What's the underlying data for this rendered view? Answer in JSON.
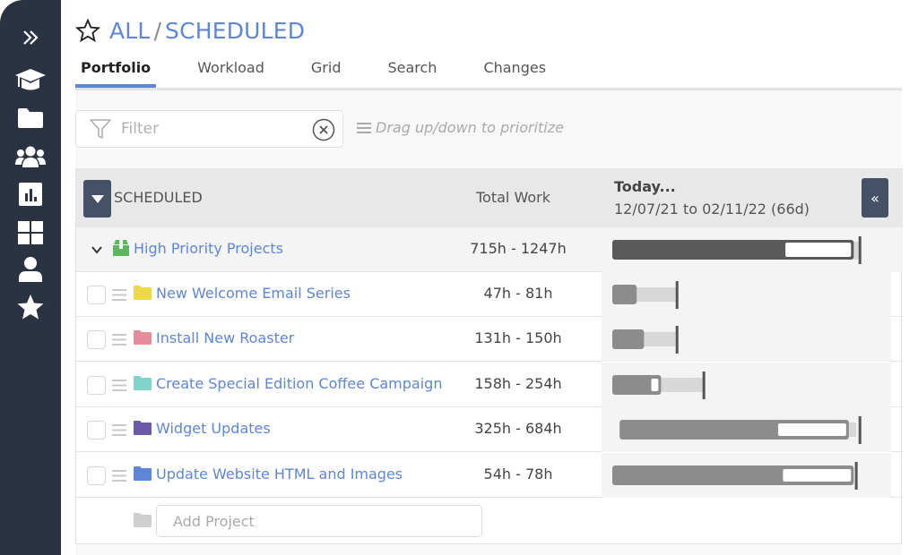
{
  "sidebar": {
    "items": [
      {
        "id": "expand",
        "icon": "double-chevron-right-icon"
      },
      {
        "id": "learn",
        "icon": "graduation-cap-icon"
      },
      {
        "id": "projects",
        "icon": "folder-icon"
      },
      {
        "id": "team",
        "icon": "users-icon"
      },
      {
        "id": "reports",
        "icon": "bar-chart-icon"
      },
      {
        "id": "dashboard",
        "icon": "grid-icon"
      },
      {
        "id": "profile",
        "icon": "user-icon"
      },
      {
        "id": "favorites",
        "icon": "star-icon"
      }
    ]
  },
  "header": {
    "breadcrumb": {
      "root": "ALL",
      "separator": "/",
      "current": "SCHEDULED"
    },
    "tabs": [
      {
        "label": "Portfolio",
        "active": true
      },
      {
        "label": "Workload",
        "active": false
      },
      {
        "label": "Grid",
        "active": false
      },
      {
        "label": "Search",
        "active": false
      },
      {
        "label": "Changes",
        "active": false
      }
    ]
  },
  "toolbar": {
    "filter_placeholder": "Filter",
    "filter_value": "",
    "drag_hint": "Drag up/down to prioritize"
  },
  "table": {
    "header": {
      "section": "SCHEDULED",
      "total_work": "Total Work",
      "today": "Today...",
      "range": "12/07/21 to 02/11/22 (66d)",
      "expand_glyph": "«"
    },
    "group": {
      "name": "High Priority Projects",
      "work": "715h - 1247h",
      "icon_color": "#5cb85c",
      "gantt": {
        "start": 0.0,
        "end": 0.99,
        "done_fraction": 0.71,
        "deadline": 1.01,
        "color": "#595959"
      }
    },
    "rows": [
      {
        "name": "New Welcome Email Series",
        "work": "47h - 81h",
        "folder_color": "#ecd94a",
        "gantt": {
          "start": 0.0,
          "done": 0.1,
          "end": 0.26,
          "deadline": 0.26,
          "inner_white": false
        }
      },
      {
        "name": "Install New Roaster",
        "work": "131h - 150h",
        "folder_color": "#e68d9b",
        "gantt": {
          "start": 0.0,
          "done": 0.13,
          "end": 0.26,
          "deadline": 0.26,
          "inner_white": false
        }
      },
      {
        "name": "Create Special Edition Coffee Campaign",
        "work": "158h - 254h",
        "folder_color": "#7fd3c8",
        "gantt": {
          "start": 0.0,
          "done": 0.2,
          "end": 0.37,
          "deadline": 0.37,
          "inner_white": true,
          "white_start": 0.16
        }
      },
      {
        "name": "Widget Updates",
        "work": "325h - 684h",
        "folder_color": "#6a5aa8",
        "gantt": {
          "start": 0.03,
          "done": 0.97,
          "end": 1.0,
          "deadline": 1.01,
          "inner_white": true,
          "white_start": 0.68
        }
      },
      {
        "name": "Update Website HTML and Images",
        "work": "54h - 78h",
        "folder_color": "#5e86d6",
        "gantt": {
          "start": 0.0,
          "done": 0.99,
          "end": 0.99,
          "deadline": 0.995,
          "inner_white": true,
          "white_start": 0.7
        }
      }
    ],
    "add_project_placeholder": "Add Project"
  },
  "colors": {
    "sidebar_bg": "#2b3241",
    "accent": "#5e86d6",
    "button_dark": "#445166",
    "bar_dark": "#595959",
    "bar_mid": "#8c8c8c",
    "bar_light": "#d8d8d8"
  }
}
